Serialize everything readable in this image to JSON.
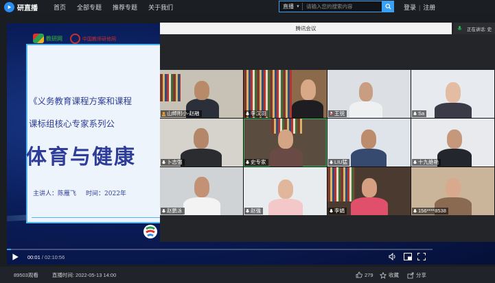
{
  "brand": {
    "name": "研直播"
  },
  "nav": {
    "items": [
      "首页",
      "全部专题",
      "推荐专题",
      "关于我们"
    ]
  },
  "search": {
    "scope": "直播",
    "placeholder": "请输入您的搜索内容"
  },
  "auth": {
    "login": "登录",
    "register": "注册",
    "separator": "|"
  },
  "slide": {
    "logo1": "教研网",
    "logo2": "中国教师研修网",
    "title1": "《义务教育课程方案和课程",
    "title2": "课标组核心专家系列公",
    "title3": "体育与健康",
    "speaker": "主讲人：陈雁飞",
    "time": "时间：2022年"
  },
  "meeting": {
    "title": "腾讯会议",
    "toast": "正在讲话: 史",
    "participants": [
      "山師附小-赵融",
      "李汉羽",
      "王锐",
      "Sa",
      "卜志强",
      "史专家",
      "LIU猛",
      "十九绝艳",
      "赵鹏泳",
      "赵強",
      "李娟",
      "156****8538"
    ],
    "active_index": 5
  },
  "player": {
    "current_time": "00:01",
    "duration": "02:10:56",
    "progress": 0.01
  },
  "footer": {
    "views": "89503观看",
    "airtime": "直播时间: 2022-05-13 14:00",
    "likes": "279",
    "favorite": "收藏",
    "share": "分享"
  },
  "colors": {
    "accent": "#3aa0f4",
    "active_speaker": "#21c05a",
    "slide_text": "#2d3d99"
  }
}
